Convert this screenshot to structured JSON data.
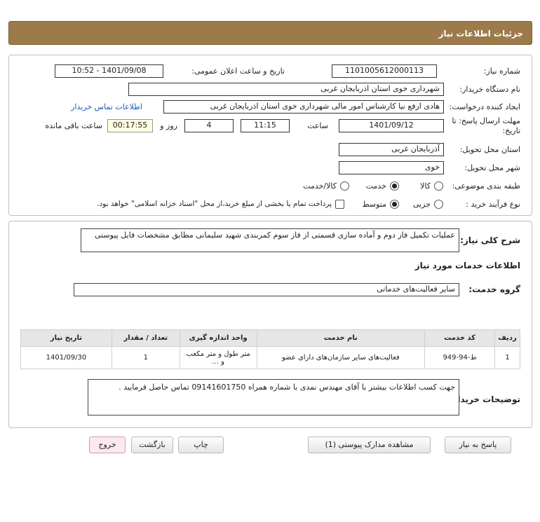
{
  "header": {
    "title": "جزئیات اطلاعات نیاز"
  },
  "form": {
    "need_number_label": "شماره نیاز:",
    "need_number": "1101005612000113",
    "announce_label": "تاریخ و ساعت اعلان عمومی:",
    "announce_value": "1401/09/08 - 10:52",
    "buyer_label": "نام دستگاه خریدار:",
    "buyer_value": "شهرداری خوی استان اذربایجان غربی",
    "creator_label": "ایجاد کننده درخواست:",
    "creator_value": "هادی ارفع نیا کارشناس امور مالی شهرداری خوی استان اذربایجان غربی",
    "contact_link": "اطلاعات تماس خریدار",
    "deadline_label_1": "مهلت ارسال پاسخ: تا",
    "deadline_label_2": "تاریخ:",
    "deadline_date": "1401/09/12",
    "time_label": "ساعت",
    "deadline_time": "11:15",
    "day_count": "4",
    "day_label": "روز و",
    "remaining_time": "00:17:55",
    "remaining_label": "ساعت باقی مانده",
    "province_label": "استان محل تحویل:",
    "province_value": "آذربایجان غربی",
    "city_label": "شهر محل تحویل:",
    "city_value": "خوی",
    "category_label": "طبقه بندی موضوعی:",
    "category_options": [
      "کالا",
      "خدمت",
      "کالا/خدمت"
    ],
    "category_selected": "خدمت",
    "process_label": "نوع فرآیند خرید :",
    "process_options": [
      "جزیی",
      "متوسط"
    ],
    "process_selected": "متوسط",
    "payment_note": "پرداخت تمام یا بخشی از مبلغ خرید،از محل \"اسناد خزانه اسلامی\" خواهد بود."
  },
  "details": {
    "description_label": "شرح کلی نیاز:",
    "description": "عملیات تکمیل فاز دوم و آماده سازی قسمتی از فاز سوم کمربندی شهید سلیمانی مطابق مشخصات فایل پیوستی",
    "services_title": "اطلاعات خدمات مورد نیاز",
    "service_group_label": "گروه خدمت:",
    "service_group": "سایر فعالیت‌های خدماتی",
    "table_headers": [
      "ردیف",
      "کد خدمت",
      "نام خدمت",
      "واحد اندازه گیری",
      "تعداد / مقدار",
      "تاریخ نیاز"
    ],
    "rows": [
      {
        "row": "1",
        "code": "ط-94-949",
        "name": "فعالیت‌های سایر سازمان‌های دارای عضو",
        "unit_1": "متر طول و متر مکعب",
        "unit_2": "و ...",
        "qty": "1",
        "date": "1401/09/30"
      }
    ],
    "buyer_notes_label": "توضیحات خریدار:",
    "buyer_notes": "جهت کسب اطلاعات بیشتر با آقای مهندس نمدی با شماره همراه 09141601750 تماس حاصل فرمایید ."
  },
  "buttons": {
    "reply": "پاسخ به نیاز",
    "attachments": "مشاهده مدارک پیوستی (1)",
    "print": "چاپ",
    "back": "بازگشت",
    "exit": "خروج"
  },
  "colors": {
    "header_bg": "#9c7a4a",
    "link": "#1a5cbf",
    "exit_button_bg": "#fde8ee"
  }
}
